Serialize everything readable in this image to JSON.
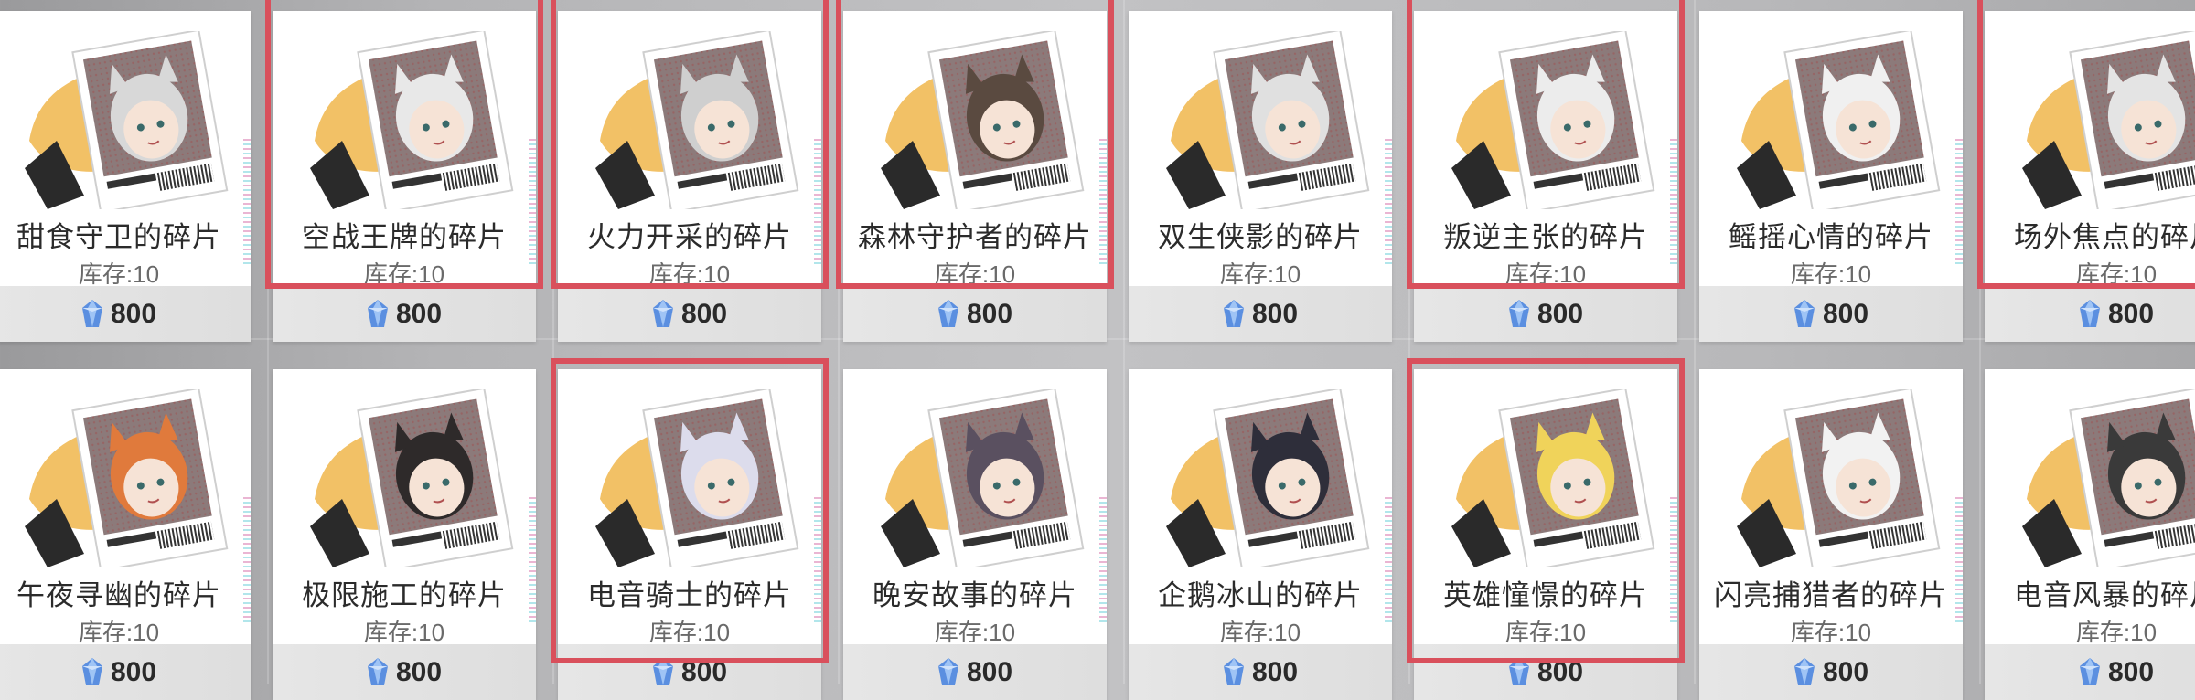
{
  "price": "800",
  "colors": {
    "highlight": "#d9505c",
    "gem": "#5b8fe0",
    "splash": "#f0b64b"
  },
  "cards": [
    {
      "name": "甜食守卫的碎片",
      "stock": "库存:10",
      "highlighted": false
    },
    {
      "name": "空战王牌的碎片",
      "stock": "库存:10",
      "highlighted": true
    },
    {
      "name": "火力开采的碎片",
      "stock": "库存:10",
      "highlighted": true
    },
    {
      "name": "森林守护者的碎片",
      "stock": "库存:10",
      "highlighted": true
    },
    {
      "name": "双生侠影的碎片",
      "stock": "库存:10",
      "highlighted": false
    },
    {
      "name": "叛逆主张的碎片",
      "stock": "库存:10",
      "highlighted": true
    },
    {
      "name": "鳐摇心情的碎片",
      "stock": "库存:10",
      "highlighted": false
    },
    {
      "name": "场外焦点的碎片",
      "stock": "库存:10",
      "highlighted": true
    },
    {
      "name": "午夜寻幽的碎片",
      "stock": "库存:10",
      "highlighted": false
    },
    {
      "name": "极限施工的碎片",
      "stock": "库存:10",
      "highlighted": false
    },
    {
      "name": "电音骑士的碎片",
      "stock": "库存:10",
      "highlighted": true
    },
    {
      "name": "晚安故事的碎片",
      "stock": "库存:10",
      "highlighted": false
    },
    {
      "name": "企鹅冰山的碎片",
      "stock": "库存:10",
      "highlighted": false
    },
    {
      "name": "英雄憧憬的碎片",
      "stock": "库存:10",
      "highlighted": true
    },
    {
      "name": "闪亮捕猎者的碎片",
      "stock": "库存:10",
      "highlighted": false
    },
    {
      "name": "电音风暴的碎片",
      "stock": "库存:10",
      "highlighted": false
    }
  ]
}
